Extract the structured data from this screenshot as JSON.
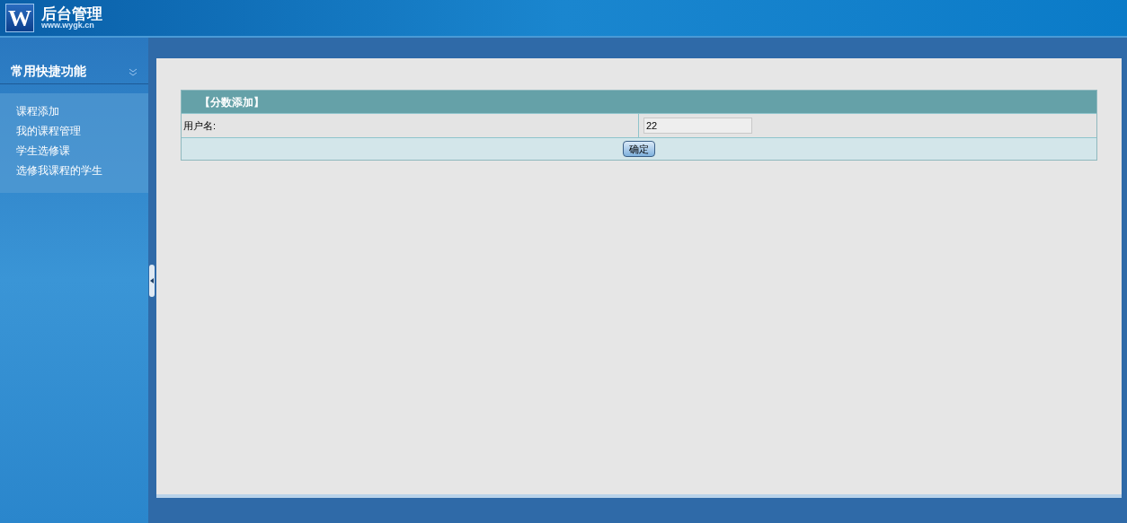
{
  "header": {
    "logo_letter": "W",
    "title": "后台管理",
    "url": "www.wygk.cn"
  },
  "sidebar": {
    "title": "常用快捷功能",
    "items": [
      {
        "label": "课程添加"
      },
      {
        "label": "我的课程管理"
      },
      {
        "label": "学生选修课"
      },
      {
        "label": "选修我课程的学生"
      }
    ]
  },
  "form": {
    "title": "【分数添加】",
    "fields": [
      {
        "label": "用户名:",
        "value": "22"
      }
    ],
    "submit": "确定"
  }
}
